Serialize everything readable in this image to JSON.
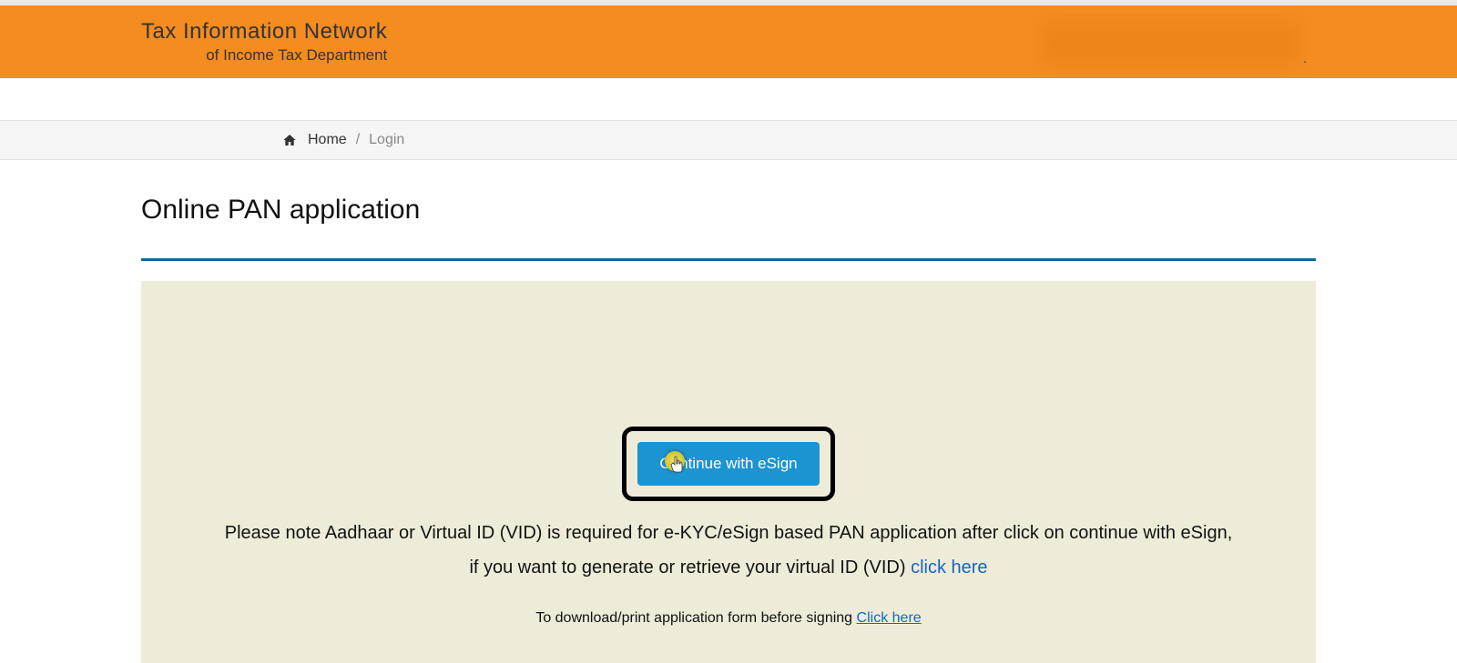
{
  "header": {
    "title_main": "Tax Information Network",
    "title_sub": "of Income Tax Department"
  },
  "breadcrumb": {
    "home_label": "Home",
    "current_label": "Login"
  },
  "page": {
    "title": "Online PAN application"
  },
  "esign": {
    "button_label": "Continue with eSign",
    "note_line1": "Please note Aadhaar or Virtual ID (VID) is required for e-KYC/eSign based PAN application after click on continue with eSign,",
    "note_line2_prefix": "if you want to generate or retrieve your virtual ID (VID) ",
    "note_line2_link": "click here",
    "download_prefix": "To download/print application form before signing ",
    "download_link": "Click here"
  }
}
